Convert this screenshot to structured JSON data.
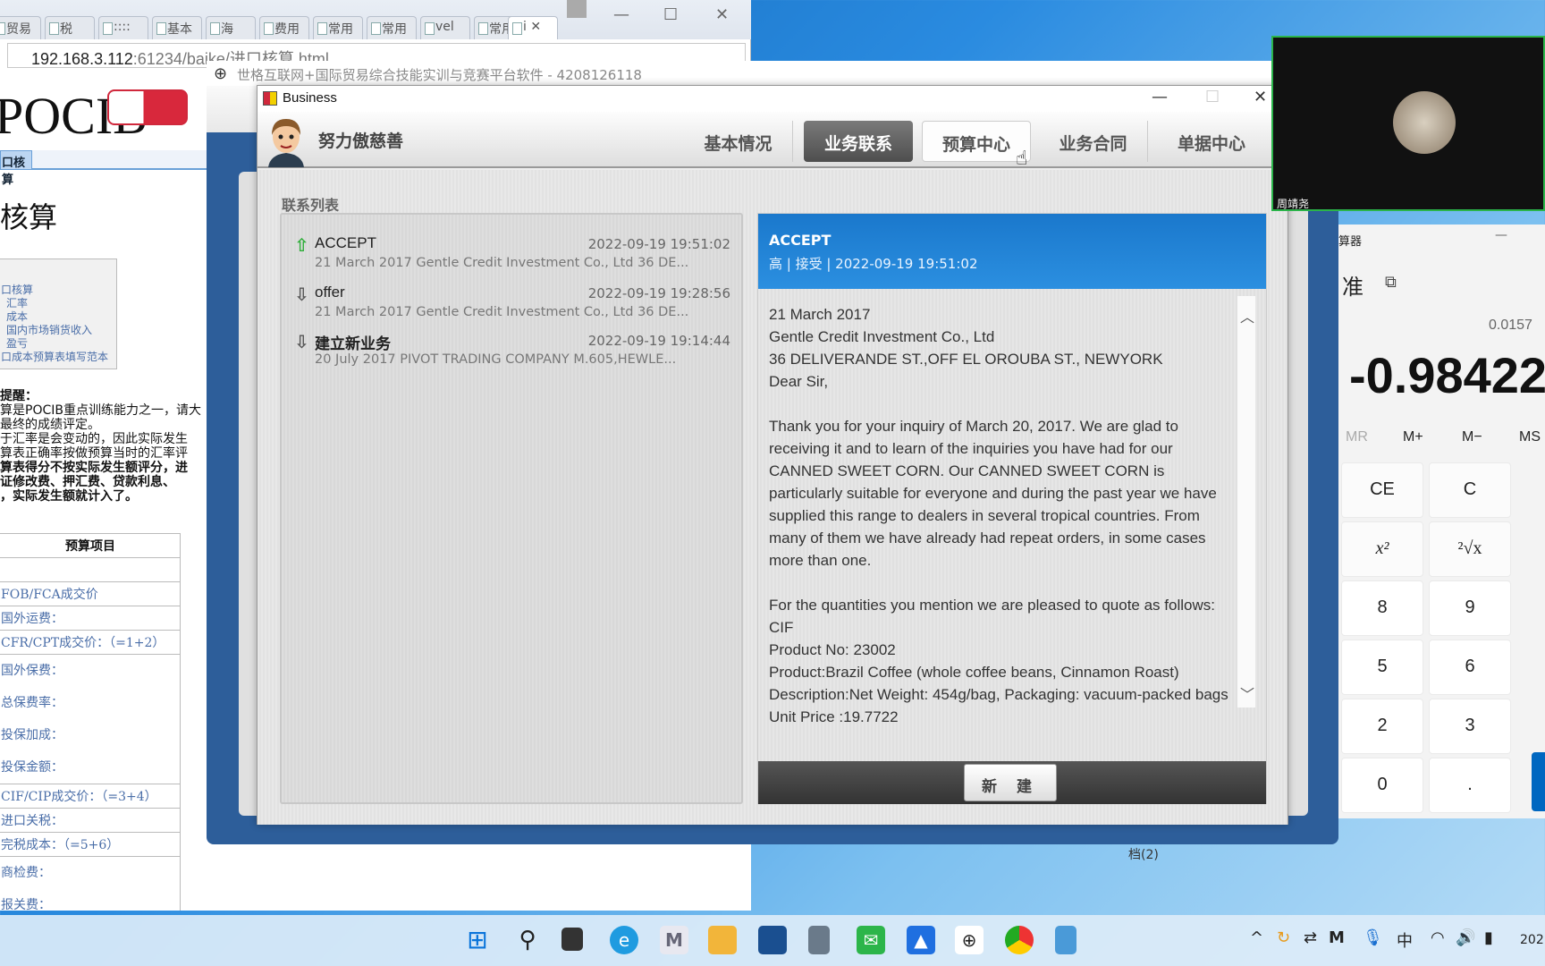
{
  "browser": {
    "tabs": [
      "贸易",
      "税",
      "::::",
      "基本",
      "海",
      "费用",
      "常用",
      "常用",
      "vel",
      "常用",
      "i"
    ],
    "url_host": "192.168.3.112",
    "url_rest": ":61234/baike/进口核算.html",
    "page": {
      "logo": "POCIB",
      "nav_tab": "口核算",
      "title": "核算",
      "links": [
        "口核算",
        "汇率",
        "成本",
        "国内市场销货收入",
        "盈亏",
        "口成本预算表填写范本"
      ],
      "notes_title": "提醒：",
      "notes": [
        {
          "text": "算是POCIB重点训练能力之一，请大",
          "bold": false
        },
        {
          "text": "最终的成绩评定。",
          "bold": false
        },
        {
          "text": "于汇率是会变动的，因此实际发生",
          "bold": false
        },
        {
          "text": "算表正确率按做预算当时的汇率评",
          "bold": false
        },
        {
          "text": "算表得分不按实际发生额评分，进",
          "bold": true
        },
        {
          "text": "证修改费、押汇费、贷款利息、",
          "bold": true
        },
        {
          "text": "，实际发生额就计入了。",
          "bold": true
        }
      ],
      "table_header": "预算项目",
      "table_rows": [
        "",
        "FOB/FCA成交价",
        "国外运费：",
        "CFR/CPT成交价：（=1+2）",
        "国外保费：\n总保费率：\n投保加成：\n投保金额：",
        "CIF/CIP成交价：（=3+4）",
        "进口关税：",
        "完税成本：（=5+6）",
        "商检费：\n报关费："
      ]
    }
  },
  "back_window": {
    "title": "世格互联网+国际贸易综合技能实训与竞赛平台软件 - 4208126118"
  },
  "business": {
    "window_title": "Business",
    "user_name": "努力傲慈善",
    "tabs": [
      {
        "label": "基本情况",
        "state": "normal"
      },
      {
        "label": "业务联系",
        "state": "active"
      },
      {
        "label": "预算中心",
        "state": "hover"
      },
      {
        "label": "业务合同",
        "state": "normal"
      },
      {
        "label": "单据中心",
        "state": "normal"
      }
    ],
    "list_label": "联系列表",
    "messages": [
      {
        "title": "ACCEPT",
        "direction": "up-arrow-icon",
        "time": "2022-09-19 19:51:02",
        "snippet": "21 March 2017 Gentle Credit Investment Co., Ltd 36 DE..."
      },
      {
        "title": "offer",
        "direction": "down-arrow-icon",
        "time": "2022-09-19 19:28:56",
        "snippet": "21 March 2017 Gentle Credit Investment Co., Ltd 36 DE..."
      },
      {
        "title": "建立新业务",
        "direction": "down-arrow-icon",
        "time": "2022-09-19 19:14:44",
        "snippet": "20 July 2017 PIVOT TRADING COMPANY M.605,HEWLE..."
      }
    ],
    "detail": {
      "title": "ACCEPT",
      "meta": "高 | 接受 | 2022-09-19 19:51:02",
      "body": [
        "21 March 2017",
        "Gentle Credit Investment Co., Ltd",
        "36 DELIVERANDE ST.,OFF EL OROUBA ST., NEWYORK",
        "Dear Sir,",
        "",
        "Thank you for your inquiry of March 20, 2017. We are glad to receiving it and to learn of the inquiries you have had for our CANNED SWEET CORN. Our CANNED SWEET CORN is particularly suitable for everyone and during the past year we have supplied this range to dealers in several tropical countries. From many of them we have already had repeat orders, in some cases more than one.",
        "",
        "For the quantities you mention we are pleased to quote as follows:",
        "CIF",
        "Product No: 23002",
        "Product:Brazil Coffee (whole coffee beans, Cinnamon Roast)",
        "Description:Net Weight: 454g/bag, Packaging: vacuum-packed bags",
        "Unit Price :19.7722"
      ],
      "new_button": "新 建"
    },
    "header_color": "#2284d8"
  },
  "video": {
    "name": "周靖尧"
  },
  "calculator": {
    "title": "算器",
    "mode": "准",
    "expression": "0.0157",
    "display": "-0.98422",
    "memory": [
      "MR",
      "M+",
      "M−",
      "MS"
    ],
    "keys": [
      "CE",
      "C",
      "x²",
      "²√x",
      "8",
      "9",
      "5",
      "6",
      "2",
      "3",
      "0",
      "."
    ]
  },
  "desktop_label": "档(2)",
  "taskbar": {
    "icons": [
      "start-icon",
      "search-icon",
      "task-view-icon",
      "edge-icon",
      "m-app-icon",
      "file-explorer-icon",
      "store-icon",
      "calculator-icon",
      "wechat-icon",
      "meeting-icon",
      "pocib-icon",
      "chrome-icon",
      "notepad-icon"
    ],
    "tray": [
      "^",
      "M",
      "中"
    ],
    "clock": "202"
  }
}
